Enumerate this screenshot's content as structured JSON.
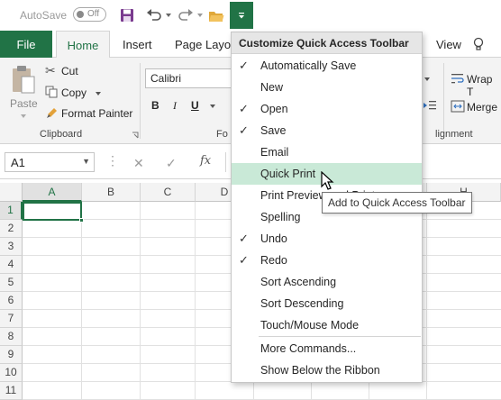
{
  "qat": {
    "autosave_label": "AutoSave",
    "autosave_state": "Off",
    "icons": [
      "save-icon",
      "undo-icon",
      "redo-icon",
      "open-folder-icon",
      "customize-qat-icon"
    ]
  },
  "tabs": [
    "File",
    "Home",
    "Insert",
    "Page Layou",
    "View"
  ],
  "ribbon": {
    "clipboard": {
      "paste": "Paste",
      "cut": "Cut",
      "copy": "Copy",
      "format_painter": "Format Painter",
      "group_label": "Clipboard"
    },
    "font": {
      "font_name": "Calibri",
      "bold": "B",
      "italic": "I",
      "underline": "U",
      "group_label": "Fo"
    },
    "alignment": {
      "wrap": "Wrap T",
      "merge": "Merge",
      "group_label": "lignment"
    }
  },
  "formula_bar": {
    "name_box": "A1",
    "fx": "fx"
  },
  "grid": {
    "columns": [
      "A",
      "B",
      "C",
      "D",
      "H"
    ],
    "rows": [
      "1",
      "2",
      "3",
      "4",
      "5",
      "6",
      "7",
      "8",
      "9",
      "10",
      "11"
    ]
  },
  "menu": {
    "title": "Customize Quick Access Toolbar",
    "items": [
      {
        "label": "Automatically Save",
        "checked": "✓"
      },
      {
        "label": "New",
        "checked": ""
      },
      {
        "label": "Open",
        "checked": "✓"
      },
      {
        "label": "Save",
        "checked": "✓"
      },
      {
        "label": "Email",
        "checked": ""
      },
      {
        "label": "Quick Print",
        "checked": ""
      },
      {
        "label": "Print Preview and Print",
        "checked": ""
      },
      {
        "label": "Spelling",
        "checked": ""
      },
      {
        "label": "Undo",
        "checked": "✓"
      },
      {
        "label": "Redo",
        "checked": "✓"
      },
      {
        "label": "Sort Ascending",
        "checked": ""
      },
      {
        "label": "Sort Descending",
        "checked": ""
      },
      {
        "label": "Touch/Mouse Mode",
        "checked": ""
      },
      {
        "label": "More Commands...",
        "checked": ""
      },
      {
        "label": "Show Below the Ribbon",
        "checked": ""
      }
    ]
  },
  "tooltip": "Add to Quick Access Toolbar",
  "colors": {
    "accent": "#217346",
    "hover": "#c9e9d7"
  }
}
